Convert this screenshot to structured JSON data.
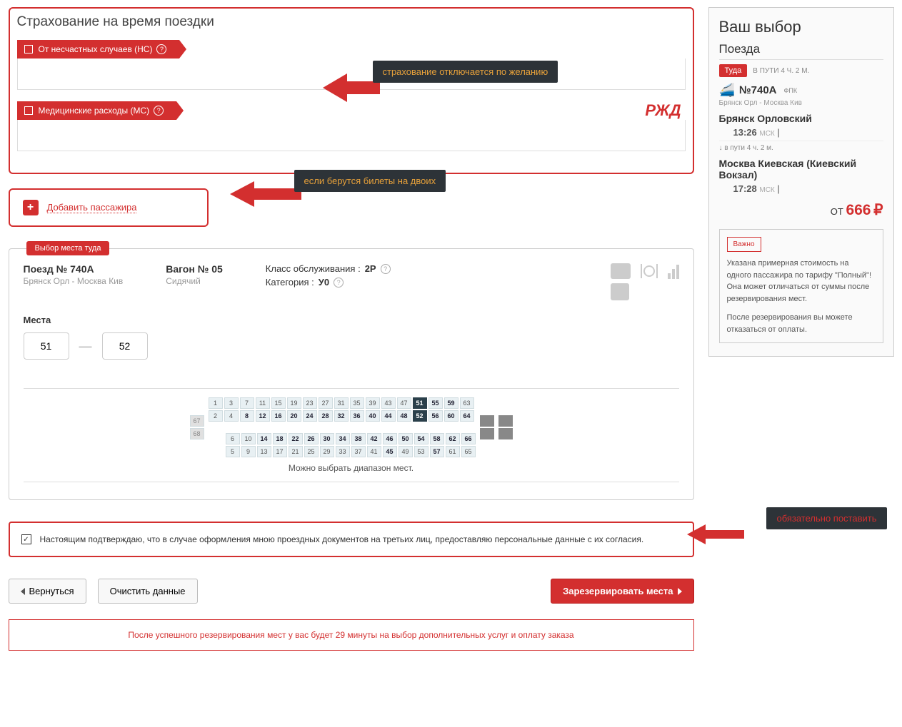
{
  "insurance": {
    "title": "Страхование на время поездки",
    "opt1": "От несчастных случаев (НС)",
    "opt2": "Медицинские расходы (МС)"
  },
  "annotations": {
    "a1": "страхование отключается по желанию",
    "a2": "если берутся билеты на двоих",
    "a3": "обязательно поставить"
  },
  "add_passenger": "Добавить пассажира",
  "seat_select": {
    "tab": "Выбор места туда",
    "train_label": "Поезд № 740А",
    "train_route": "Брянск Орл - Москва Кив",
    "car_label": "Вагон № 05",
    "car_type": "Сидячий",
    "class_label": "Класс обслуживания :",
    "class_val": "2Р",
    "cat_label": "Категория :",
    "cat_val": "У0",
    "seats_label": "Места",
    "seat_from": "51",
    "seat_to": "52",
    "map_note": "Можно выбрать диапазон мест."
  },
  "seatmap": {
    "side_top": "67",
    "side_bot": "68",
    "r1": [
      "1",
      "3",
      "7",
      "11",
      "15",
      "19",
      "23",
      "27",
      "31",
      "35",
      "39",
      "43",
      "47",
      "51",
      "55",
      "59",
      "63"
    ],
    "r2": [
      "2",
      "4",
      "8",
      "12",
      "16",
      "20",
      "24",
      "28",
      "32",
      "36",
      "40",
      "44",
      "48",
      "52",
      "56",
      "60",
      "64"
    ],
    "r3": [
      "6",
      "10",
      "14",
      "18",
      "22",
      "26",
      "30",
      "34",
      "38",
      "42",
      "46",
      "50",
      "54",
      "58",
      "62",
      "66"
    ],
    "r4": [
      "5",
      "9",
      "13",
      "17",
      "21",
      "25",
      "29",
      "33",
      "37",
      "41",
      "45",
      "49",
      "53",
      "57",
      "61",
      "65"
    ],
    "bold1": [
      "51",
      "55",
      "59"
    ],
    "bold2": [
      "8",
      "12",
      "16",
      "20",
      "24",
      "28",
      "32",
      "36",
      "40",
      "44",
      "48",
      "52",
      "56",
      "60",
      "64"
    ],
    "bold3": [
      "14",
      "18",
      "22",
      "26",
      "30",
      "34",
      "38",
      "42",
      "46",
      "50",
      "54",
      "58",
      "62",
      "66"
    ],
    "bold4": [
      "45",
      "57"
    ],
    "selected": [
      "51",
      "52"
    ]
  },
  "consent": "Настоящим подтверждаю, что в случае оформления мною проездных документов на третьих лиц, предоставляю персональные данные с их согласия.",
  "buttons": {
    "back": "Вернуться",
    "clear": "Очистить данные",
    "reserve": "Зарезервировать места"
  },
  "footer_note": "После успешного резервирования мест у вас будет 29 минуты на выбор дополнительных услуг и оплату заказа",
  "sidebar": {
    "title": "Ваш выбор",
    "section": "Поезда",
    "dir": "Туда",
    "duration_top": "В ПУТИ 4 Ч. 2 М.",
    "train_no": "№740А",
    "fpk": "ФПК",
    "route": "Брянск Орл - Москва Кив",
    "station_from": "Брянск Орловский",
    "time_from": "13:26",
    "msk": "МСК",
    "duration_mid": "в пути  4 ч. 2 м.",
    "station_to": "Москва Киевская (Киевский Вокзал)",
    "time_to": "17:28",
    "price_prefix": "ОТ",
    "price": "666",
    "rub": "₽",
    "imp_badge": "Важно",
    "imp_text1": "Указана примерная стоимость на одного пассажира по тарифу \"Полный\"! Она может отличаться от суммы после резервирования мест.",
    "imp_text2": "После резервирования вы можете отказаться от оплаты."
  }
}
